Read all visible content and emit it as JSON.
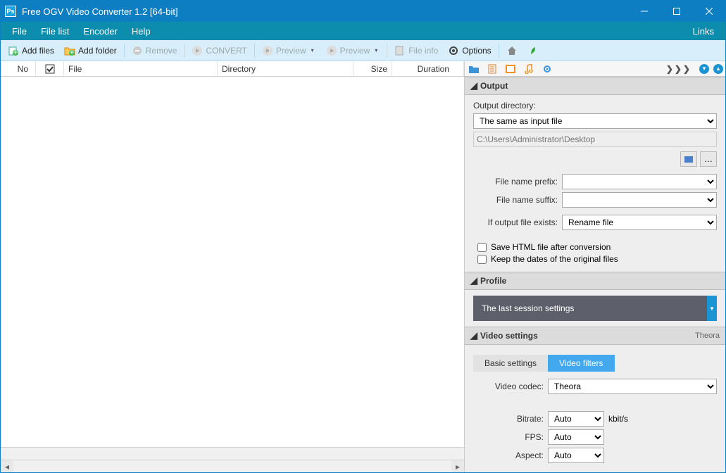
{
  "window": {
    "title": "Free OGV Video Converter 1.2  [64-bit]"
  },
  "menu": {
    "file": "File",
    "filelist": "File list",
    "encoder": "Encoder",
    "help": "Help",
    "links": "Links"
  },
  "toolbar": {
    "add_files": "Add files",
    "add_folder": "Add folder",
    "remove": "Remove",
    "convert": "CONVERT",
    "preview1": "Preview",
    "preview2": "Preview",
    "file_info": "File info",
    "options": "Options"
  },
  "columns": {
    "no": "No",
    "file": "File",
    "directory": "Directory",
    "size": "Size",
    "duration": "Duration"
  },
  "output": {
    "section": "Output",
    "dir_label": "Output directory:",
    "dir_select": "The same as input file",
    "dir_path": "C:\\Users\\Administrator\\Desktop",
    "prefix_label": "File name prefix:",
    "suffix_label": "File name suffix:",
    "exists_label": "If output file exists:",
    "exists_value": "Rename file",
    "save_html": "Save HTML file after conversion",
    "keep_dates": "Keep the dates of the original files"
  },
  "profile": {
    "section": "Profile",
    "value": "The last session settings"
  },
  "video": {
    "section": "Video settings",
    "codec_name": "Theora",
    "tab_basic": "Basic settings",
    "tab_filters": "Video filters",
    "codec_label": "Video codec:",
    "codec_value": "Theora",
    "bitrate_label": "Bitrate:",
    "bitrate_value": "Auto",
    "bitrate_unit": "kbit/s",
    "fps_label": "FPS:",
    "fps_value": "Auto",
    "aspect_label": "Aspect:",
    "aspect_value": "Auto"
  }
}
